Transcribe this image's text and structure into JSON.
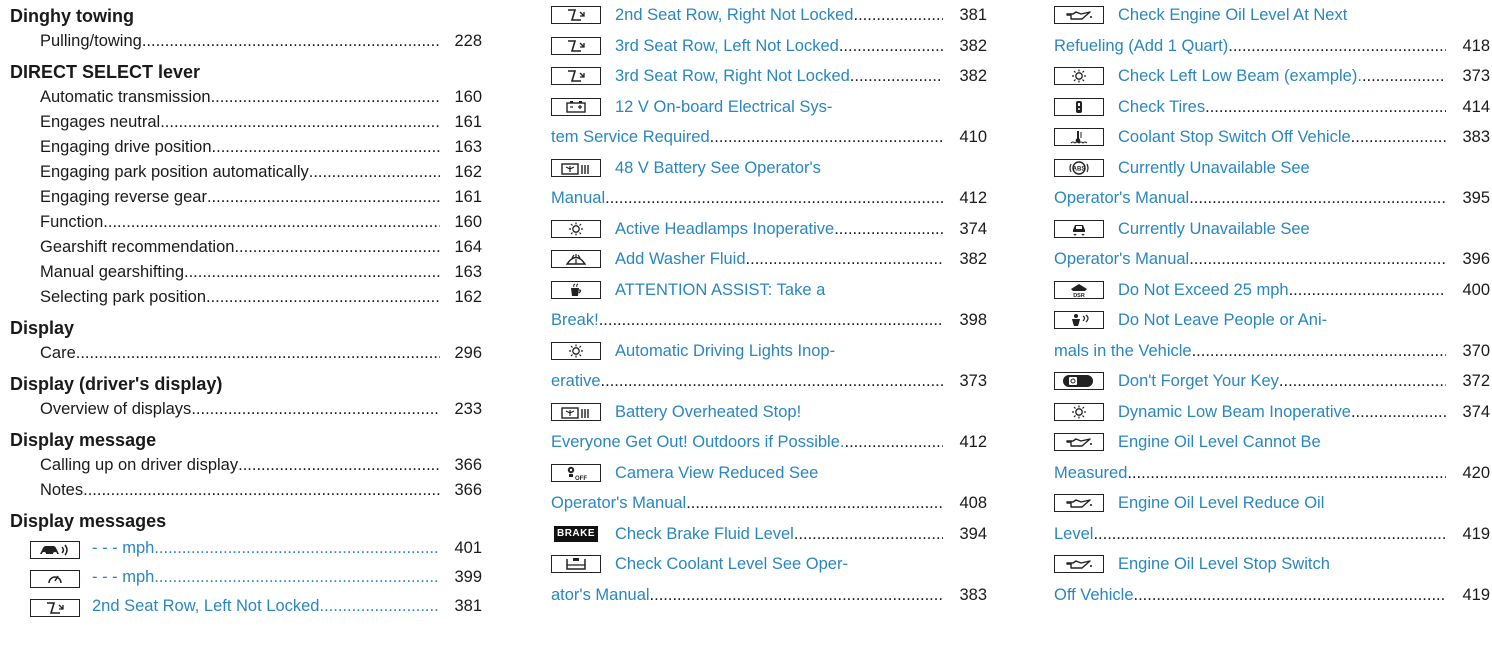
{
  "col1": {
    "dinghy": {
      "heading": "Dinghy towing",
      "entries": [
        {
          "label": "Pulling/towing",
          "page": "228"
        }
      ]
    },
    "direct_select": {
      "heading": "DIRECT SELECT lever",
      "entries": [
        {
          "label": "Automatic transmission",
          "page": "160"
        },
        {
          "label": "Engages neutral",
          "page": "161"
        },
        {
          "label": "Engaging drive position",
          "page": "163"
        },
        {
          "label": "Engaging park position automatically",
          "page": "162"
        },
        {
          "label": "Engaging reverse gear",
          "page": "161"
        },
        {
          "label": "Function",
          "page": "160"
        },
        {
          "label": "Gearshift recommendation",
          "page": "164"
        },
        {
          "label": "Manual gearshifting",
          "page": "163"
        },
        {
          "label": "Selecting park position",
          "page": "162"
        }
      ]
    },
    "display": {
      "heading": "Display",
      "entries": [
        {
          "label": "Care",
          "page": "296"
        }
      ]
    },
    "display_driver": {
      "heading": "Display (driver's display)",
      "entries": [
        {
          "label": "Overview of displays",
          "page": "233"
        }
      ]
    },
    "display_message": {
      "heading": "Display message",
      "entries": [
        {
          "label": "Calling up on driver display",
          "page": "366"
        },
        {
          "label": "Notes",
          "page": "366"
        }
      ]
    },
    "display_messages": {
      "heading": "Display messages",
      "entries": [
        {
          "icon": "distance-warning-icon",
          "label": "- - - mph",
          "page": "401"
        },
        {
          "icon": "speed-limiter-icon",
          "label": "- - - mph",
          "page": "399"
        },
        {
          "icon": "seat-icon",
          "label": "2nd Seat Row, Left Not Locked",
          "page": "381"
        }
      ]
    }
  },
  "col2": [
    {
      "icon": "seat-icon",
      "lines": [
        "2nd Seat Row, Right Not Locked"
      ],
      "page": "381"
    },
    {
      "icon": "seat-icon",
      "lines": [
        "3rd Seat Row, Left Not Locked"
      ],
      "page": "382"
    },
    {
      "icon": "seat-icon",
      "lines": [
        "3rd Seat Row, Right Not Locked"
      ],
      "page": "382"
    },
    {
      "icon": "battery-icon",
      "lines": [
        "12 V On-board Electrical Sys-",
        "tem Service Required"
      ],
      "page": "410"
    },
    {
      "icon": "battery-48v-icon",
      "lines": [
        "48 V Battery See Operator's",
        "Manual"
      ],
      "page": "412"
    },
    {
      "icon": "headlamp-icon",
      "lines": [
        "Active Headlamps Inoperative"
      ],
      "page": "374"
    },
    {
      "icon": "washer-fluid-icon",
      "lines": [
        "Add Washer Fluid"
      ],
      "page": "382"
    },
    {
      "icon": "coffee-cup-icon",
      "lines": [
        "ATTENTION ASSIST: Take a",
        "Break!"
      ],
      "page": "398"
    },
    {
      "icon": "headlamp-icon",
      "lines": [
        "Automatic Driving Lights Inop-",
        "erative"
      ],
      "page": "373"
    },
    {
      "icon": "battery-48v-icon",
      "lines": [
        "Battery Overheated Stop!",
        "Everyone Get Out! Outdoors if Possible."
      ],
      "page": "412"
    },
    {
      "icon": "camera-off-icon",
      "lines": [
        "Camera View Reduced See",
        "Operator's Manual"
      ],
      "page": "408"
    },
    {
      "icon": "brake-icon",
      "icon_text": "BRAKE",
      "lines": [
        "Check Brake Fluid Level"
      ],
      "page": "394"
    },
    {
      "icon": "coolant-reservoir-icon",
      "lines": [
        "Check Coolant Level See Oper-",
        "ator's Manual"
      ],
      "page": "383"
    }
  ],
  "col3": [
    {
      "icon": "oil-can-icon",
      "lines": [
        "Check Engine Oil Level At Next",
        "Refueling (Add 1 Quart)"
      ],
      "page": "418"
    },
    {
      "icon": "headlamp-icon",
      "lines": [
        "Check Left Low Beam (example)."
      ],
      "page": "373"
    },
    {
      "icon": "tire-pressure-icon",
      "lines": [
        "Check Tires"
      ],
      "page": "414"
    },
    {
      "icon": "coolant-temperature-icon",
      "lines": [
        "Coolant Stop Switch Off Vehicle"
      ],
      "page": "383"
    },
    {
      "icon": "abs-icon",
      "lines": [
        "Currently Unavailable See",
        "Operator's Manual"
      ],
      "page": "395"
    },
    {
      "icon": "car-skid-icon",
      "lines": [
        "Currently Unavailable See",
        "Operator's Manual"
      ],
      "page": "396"
    },
    {
      "icon": "dsr-icon",
      "lines": [
        "Do Not Exceed 25 mph"
      ],
      "page": "400"
    },
    {
      "icon": "person-in-vehicle-icon",
      "lines": [
        "Do Not Leave People or Ani-",
        "mals in the Vehicle"
      ],
      "page": "370"
    },
    {
      "icon": "key-icon",
      "lines": [
        "Don't Forget Your Key"
      ],
      "page": "372"
    },
    {
      "icon": "headlamp-icon",
      "lines": [
        "Dynamic Low Beam Inoperative"
      ],
      "page": "374"
    },
    {
      "icon": "oil-can-icon",
      "lines": [
        "Engine Oil Level Cannot Be",
        "Measured"
      ],
      "page": "420"
    },
    {
      "icon": "oil-can-icon",
      "lines": [
        "Engine Oil Level Reduce Oil",
        "Level"
      ],
      "page": "419"
    },
    {
      "icon": "oil-can-icon",
      "lines": [
        "Engine Oil Level Stop Switch",
        "Off Vehicle"
      ],
      "page": "419"
    }
  ]
}
